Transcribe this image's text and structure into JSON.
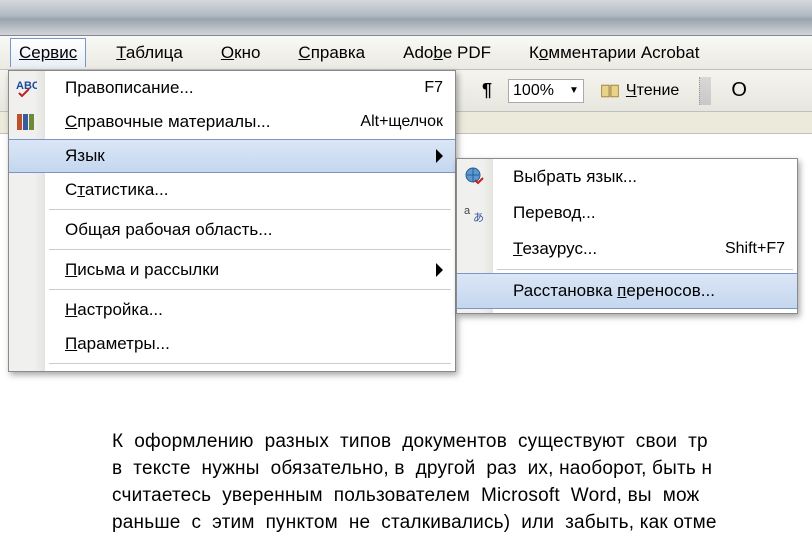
{
  "menubar": {
    "service": "Сервис",
    "table_pre": "Т",
    "table_rest": "аблица",
    "window_pre": "О",
    "window_rest": "кно",
    "help_pre": "С",
    "help_rest": "правка",
    "adobe_pre": "Ado",
    "adobe_u": "b",
    "adobe_rest": "e PDF",
    "comments_pre": "К",
    "comments_u": "о",
    "comments_rest": "мментарии Acrobat"
  },
  "toolbar": {
    "pilcrow": "¶",
    "zoom": "100%",
    "reading_u": "Ч",
    "reading_rest": "тение",
    "tail_o": "О"
  },
  "menu": {
    "spelling": "Правописание...",
    "spelling_sc": "F7",
    "research_pre": "С",
    "research_rest": "правочные материалы...",
    "research_sc": "Alt+щелчок",
    "language": "Язык",
    "stats_pre": "С",
    "stats_u": "т",
    "stats_rest": "атистика...",
    "shared": "Общая рабочая область...",
    "mail_pre": "П",
    "mail_rest": "исьма и рассылки",
    "custom_pre": "Н",
    "custom_rest": "астройка...",
    "options_pre": "П",
    "options_rest": "араметры..."
  },
  "submenu": {
    "choose": "Выбрать язык...",
    "translate": "Перевод...",
    "thesaurus_pre": "Т",
    "thesaurus_rest": "езаурус...",
    "thesaurus_sc": "Shift+F7",
    "hyphen_pre": "Расстановка ",
    "hyphen_u": "п",
    "hyphen_rest": "ереносов..."
  },
  "doc": {
    "l1": "К  оформлению  разных  типов  документов  существуют  свои  тр",
    "l2": "в  тексте  нужны  обязательно, в  другой  раз  их, наоборот, быть н",
    "l3": "считаетесь  уверенным  пользователем  Microsoft  Word, вы  мож",
    "l4": "раньше  с  этим  пунктом  не  сталкивались)  или  забыть, как отме"
  }
}
